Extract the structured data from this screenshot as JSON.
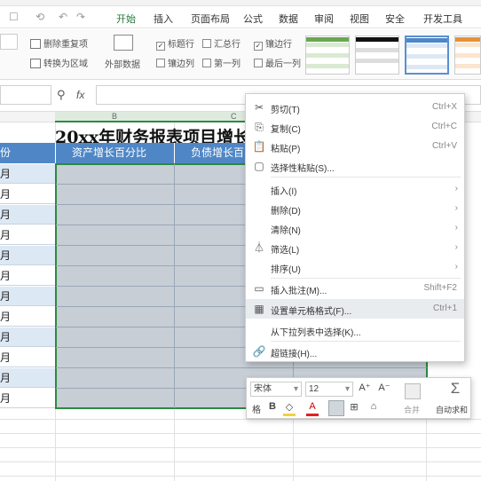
{
  "menu": {
    "quick_access": [
      "☐",
      "⟲",
      "↶",
      "↷"
    ],
    "tabs": [
      "开始",
      "插入",
      "页面布局",
      "公式",
      "数据",
      "审阅",
      "视图",
      "安全",
      "开发工具"
    ]
  },
  "ribbon": {
    "row1": [
      "删除重复项",
      "标题行",
      "汇总行",
      "镶边行"
    ],
    "row2": [
      "转换为区域",
      "外部数据",
      "镶边列",
      "第一列",
      "最后一列"
    ]
  },
  "formula": {
    "fx": "fx",
    "zoom_icon": "magnifier-icon"
  },
  "columns": [
    "B",
    "C"
  ],
  "sheet": {
    "title": "20xx年财务报表项目增长",
    "header": [
      "份",
      "资产增长百分比",
      "负债增长百"
    ],
    "row_labels": [
      "月",
      "月",
      "月",
      "月",
      "月",
      "月",
      "月",
      "月",
      "月",
      "月",
      "月",
      "月"
    ]
  },
  "context_menu": {
    "items": [
      {
        "icon": "✂",
        "label": "剪切(T)",
        "shortcut": "Ctrl+X"
      },
      {
        "icon": "⎘",
        "label": "复制(C)",
        "shortcut": "Ctrl+C"
      },
      {
        "icon": "📋",
        "label": "粘贴(P)",
        "shortcut": "Ctrl+V"
      },
      {
        "icon": "▢",
        "label": "选择性粘贴(S)...",
        "shortcut": ""
      },
      {
        "icon": "",
        "label": "插入(I)",
        "shortcut": "›"
      },
      {
        "icon": "",
        "label": "删除(D)",
        "shortcut": "›"
      },
      {
        "icon": "",
        "label": "清除(N)",
        "shortcut": "›"
      },
      {
        "icon": "⏃",
        "label": "筛选(L)",
        "shortcut": "›"
      },
      {
        "icon": "",
        "label": "排序(U)",
        "shortcut": "›"
      },
      {
        "icon": "▭",
        "label": "插入批注(M)...",
        "shortcut": "Shift+F2"
      },
      {
        "icon": "▦",
        "label": "设置单元格格式(F)...",
        "shortcut": "Ctrl+1"
      },
      {
        "icon": "",
        "label": "从下拉列表中选择(K)...",
        "shortcut": ""
      },
      {
        "icon": "🔗",
        "label": "超链接(H)...",
        "shortcut": ""
      }
    ]
  },
  "mini_toolbar": {
    "font": "宋体",
    "size": "12",
    "grow": "A⁺",
    "shrink": "A⁻",
    "bold": "B",
    "format_painter": "格",
    "fill_label": "",
    "font_color": "A",
    "merge": "合并",
    "sum_label": "自动求和"
  },
  "colors": {
    "header_blue": "#4f87c6",
    "row_blue": "#dde8f5",
    "grey_cell": "#c7ced6",
    "selection_green": "#2c8a3f"
  }
}
